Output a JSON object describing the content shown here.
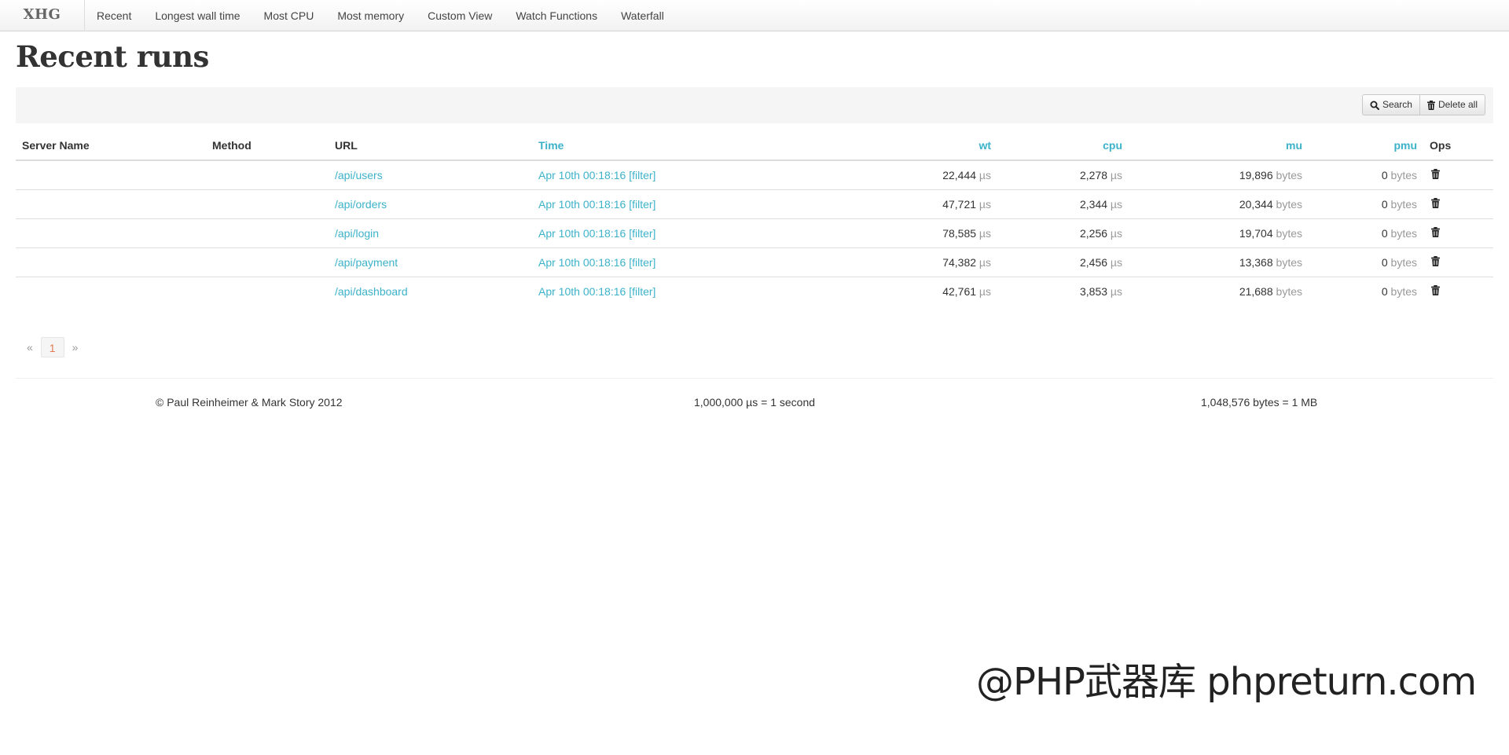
{
  "brand": "XHG",
  "nav": [
    "Recent",
    "Longest wall time",
    "Most CPU",
    "Most memory",
    "Custom View",
    "Watch Functions",
    "Waterfall"
  ],
  "page_title": "Recent runs",
  "toolbar": {
    "search_label": "Search",
    "delete_all_label": "Delete all"
  },
  "table": {
    "headers": {
      "server": "Server Name",
      "method": "Method",
      "url": "URL",
      "time": "Time",
      "wt": "wt",
      "cpu": "cpu",
      "mu": "mu",
      "pmu": "pmu",
      "ops": "Ops"
    },
    "rows": [
      {
        "server": "",
        "method": "",
        "url": "/api/users",
        "time": "Apr 10th 00:18:16",
        "filter": "[filter]",
        "wt": "22,444",
        "wt_unit": "µs",
        "cpu": "2,278",
        "cpu_unit": "µs",
        "mu": "19,896",
        "mu_unit": "bytes",
        "pmu": "0",
        "pmu_unit": "bytes"
      },
      {
        "server": "",
        "method": "",
        "url": "/api/orders",
        "time": "Apr 10th 00:18:16",
        "filter": "[filter]",
        "wt": "47,721",
        "wt_unit": "µs",
        "cpu": "2,344",
        "cpu_unit": "µs",
        "mu": "20,344",
        "mu_unit": "bytes",
        "pmu": "0",
        "pmu_unit": "bytes"
      },
      {
        "server": "",
        "method": "",
        "url": "/api/login",
        "time": "Apr 10th 00:18:16",
        "filter": "[filter]",
        "wt": "78,585",
        "wt_unit": "µs",
        "cpu": "2,256",
        "cpu_unit": "µs",
        "mu": "19,704",
        "mu_unit": "bytes",
        "pmu": "0",
        "pmu_unit": "bytes"
      },
      {
        "server": "",
        "method": "",
        "url": "/api/payment",
        "time": "Apr 10th 00:18:16",
        "filter": "[filter]",
        "wt": "74,382",
        "wt_unit": "µs",
        "cpu": "2,456",
        "cpu_unit": "µs",
        "mu": "13,368",
        "mu_unit": "bytes",
        "pmu": "0",
        "pmu_unit": "bytes"
      },
      {
        "server": "",
        "method": "",
        "url": "/api/dashboard",
        "time": "Apr 10th 00:18:16",
        "filter": "[filter]",
        "wt": "42,761",
        "wt_unit": "µs",
        "cpu": "3,853",
        "cpu_unit": "µs",
        "mu": "21,688",
        "mu_unit": "bytes",
        "pmu": "0",
        "pmu_unit": "bytes"
      }
    ]
  },
  "pagination": {
    "prev": "«",
    "current": "1",
    "next": "»"
  },
  "footer": {
    "copyright": "© Paul Reinheimer & Mark Story 2012",
    "time_note": "1,000,000 µs = 1 second",
    "size_note": "1,048,576 bytes = 1 MB"
  },
  "watermark": "@PHP武器库 phpreturn.com",
  "colors": {
    "link": "#3cb2c9",
    "active_page": "#e07b53",
    "unit": "#999999"
  },
  "icons": {
    "search": "search-icon",
    "delete_all": "trash-icon",
    "row_delete": "trash-icon"
  }
}
